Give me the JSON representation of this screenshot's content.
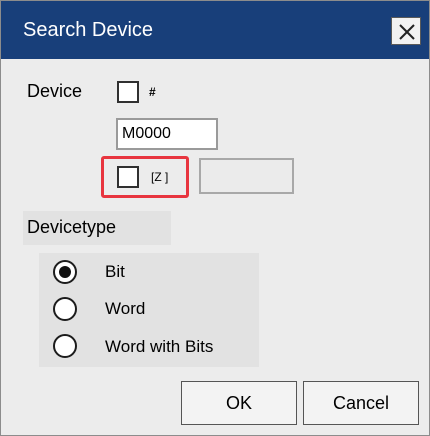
{
  "dialog": {
    "title": "Search Device",
    "close_glyph": "×"
  },
  "device": {
    "label": "Device",
    "hash_label": "#",
    "value": "M0000",
    "index_label": "[Z ]",
    "index_value": ""
  },
  "devicetype": {
    "label": "Devicetype",
    "options": [
      {
        "label": "Bit",
        "selected": true
      },
      {
        "label": "Word",
        "selected": false
      },
      {
        "label": "Word with Bits",
        "selected": false
      }
    ]
  },
  "buttons": {
    "ok": "OK",
    "cancel": "Cancel"
  },
  "colors": {
    "titlebar": "#183f7a",
    "highlight": "#e8353f"
  }
}
